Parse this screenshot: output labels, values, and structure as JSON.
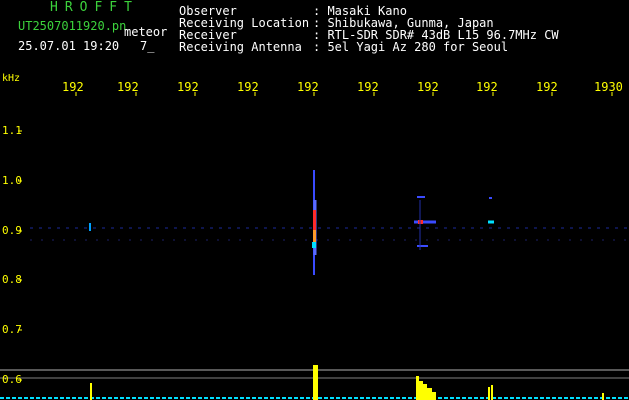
{
  "header": {
    "logo_text": "HROFFT",
    "file_name": "UT2507011920.pn",
    "file_type": "meteor",
    "datetime": "25.07.01 19:20",
    "count": "7_"
  },
  "info": [
    {
      "label": "Observer",
      "value": ": Masaki Kano"
    },
    {
      "label": "Receiving Location",
      "value": ": Shibukawa, Gunma, Japan"
    },
    {
      "label": "Receiver",
      "value": ": RTL-SDR SDR# 43dB L15 96.7MHz CW"
    },
    {
      "label": "Receiving Antenna",
      "value": ": 5el Yagi Az 280 for Seoul"
    }
  ],
  "axis": {
    "y_unit": "kHz",
    "x_ticks": [
      "192",
      "192",
      "192",
      "192",
      "192",
      "192",
      "192",
      "192",
      "192",
      "1930"
    ],
    "y_ticks": [
      "1.1",
      "1.0",
      "0.9",
      "0.8",
      "0.7",
      "0.6"
    ]
  },
  "colors": {
    "text_green": "#3cd23c",
    "text_white": "#ffffff",
    "axis_yellow": "#ffff00",
    "signal_blue": "#3a4bff",
    "signal_red": "#ff2a2a",
    "signal_cyan": "#00e0ff",
    "histogram_yellow": "#ffff00"
  }
}
